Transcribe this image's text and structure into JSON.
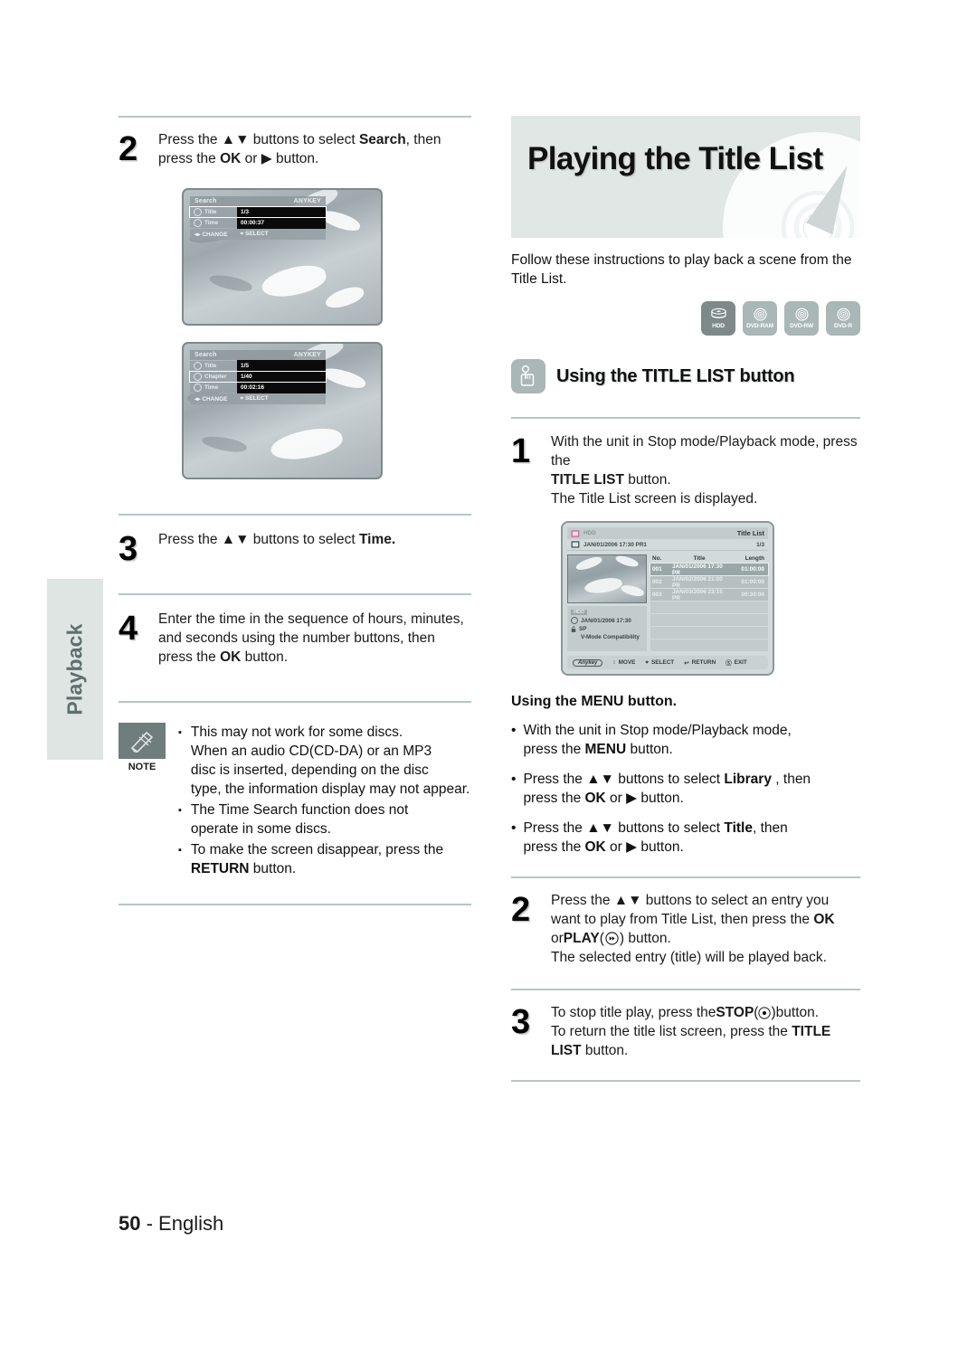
{
  "page": {
    "number": "50",
    "language": "English",
    "side_tab": "Playback"
  },
  "left_column": {
    "step2": {
      "num": "2",
      "line1_pre": "Press the ",
      "line1_arrows": "▲▼",
      "line1_mid": " buttons to select ",
      "line1_bold": "Search",
      "line1_post": ", then",
      "line2_pre": "press the ",
      "line2_bold": "OK",
      "line2_mid": " or ",
      "line2_arrow": "▶",
      "line2_post": " button."
    },
    "screen_a": {
      "title": "Search",
      "anykey": "ANYKEY",
      "rows": [
        {
          "icon": "title-icon",
          "label": "Title",
          "value": "1/3",
          "selected": true
        },
        {
          "icon": "clock-icon",
          "label": "Time",
          "value": "00:00:37",
          "selected": false
        }
      ],
      "foot_change": "CHANGE",
      "foot_select": "SELECT"
    },
    "screen_b": {
      "title": "Search",
      "anykey": "ANYKEY",
      "rows": [
        {
          "icon": "title-icon",
          "label": "Title",
          "value": "1/5",
          "selected": false
        },
        {
          "icon": "chapter-icon",
          "label": "Chapter",
          "value": "1/40",
          "selected": true
        },
        {
          "icon": "clock-icon",
          "label": "Time",
          "value": "00:02:16",
          "selected": false
        }
      ],
      "foot_change": "CHANGE",
      "foot_select": "SELECT"
    },
    "step3": {
      "num": "3",
      "pre": "Press the ",
      "arrows": "▲▼",
      "mid": " buttons to select ",
      "bold": "Time.",
      "post": ""
    },
    "step4": {
      "num": "4",
      "line1": "Enter the time in the sequence of hours, minutes,",
      "line2": "and seconds using the number buttons, then",
      "line3_pre": "press the ",
      "line3_bold": "OK",
      "line3_post": " button."
    },
    "note": {
      "icon": "pencil-note-icon",
      "caption": "NOTE",
      "items": [
        {
          "bullet": "▪",
          "lines": [
            "This may not work for some discs.",
            "When an audio CD(CD-DA) or an MP3",
            "disc is inserted, depending on the disc",
            "type, the information display may not appear."
          ]
        },
        {
          "bullet": "▪",
          "lines": [
            "The Time Search function does not",
            "operate in some discs."
          ]
        },
        {
          "bullet": "▪",
          "lines": [
            "To make the screen disappear, press the"
          ],
          "last_bold": "RETURN",
          "last_post": " button."
        }
      ]
    }
  },
  "right_column": {
    "header_title": "Playing the Title List",
    "intro_line1": "Follow these instructions to play back a scene from the",
    "intro_line2": "Title List.",
    "badges": [
      {
        "name": "hdd-badge",
        "label": "HDD",
        "glyph": "hdd-stack-icon",
        "active": true
      },
      {
        "name": "dvd-ram-badge",
        "label": "DVD-RAM",
        "glyph": "disc-icon",
        "active": false
      },
      {
        "name": "dvd-rw-badge",
        "label": "DVD-RW",
        "glyph": "disc-icon",
        "active": false
      },
      {
        "name": "dvd-r-badge",
        "label": "DVD-R",
        "glyph": "disc-icon",
        "active": false
      }
    ],
    "section_title": "Using the TITLE LIST button",
    "section_icon": "hand-press-icon",
    "step1": {
      "num": "1",
      "line1": "With the unit in Stop mode/Playback mode, press the",
      "line2_bold": "TITLE LIST",
      "line2_post": " button.",
      "line3": "The Title List screen is displayed."
    },
    "title_list_screen": {
      "source_label": "HDD",
      "source_icon": "hdd-small-icon",
      "screen_name": "Title List",
      "sub_icon": "film-icon",
      "sub_label": "JAN/01/2006 17:30 PR1",
      "page_indicator": "1/3",
      "columns": {
        "no": "No.",
        "title": "Title",
        "length": "Length"
      },
      "rows": [
        {
          "no": "001",
          "title": "JAN/01/2006 17:30 PR",
          "length": "01:00:00",
          "selected": true
        },
        {
          "no": "002",
          "title": "JAN/02/2006 21:00 PR",
          "length": "01:00:00",
          "selected": false
        },
        {
          "no": "003",
          "title": "JAN/03/2006 23:15 PR",
          "length": "00:30:00",
          "selected": false
        }
      ],
      "empty_rows": 4,
      "info": {
        "tag": "HDD",
        "date": "JAN/01/2006 17:30",
        "mode": "SP",
        "compat": "V-Mode Compatibility",
        "clock_icon": "clock-icon",
        "lock_icon": "unlock-icon"
      },
      "footer": {
        "anykey": "Anykey",
        "move": "MOVE",
        "select": "SELECT",
        "return": "RETURN",
        "exit": "EXIT"
      }
    },
    "menu_section": {
      "heading": "Using the MENU button.",
      "bullets": [
        {
          "bullet": "•",
          "line1": "With the unit in Stop mode/Playback mode,",
          "line2_pre": "press the ",
          "line2_bold": "MENU",
          "line2_post": " button."
        },
        {
          "bullet": "•",
          "line1_pre": "Press the ",
          "line1_arrows": "▲▼",
          "line1_mid": " buttons to select ",
          "line1_bold": "Library",
          "line1_post": " , then",
          "line2_pre": "press the ",
          "line2_bold": "OK",
          "line2_mid": " or ",
          "line2_arrow": "▶",
          "line2_post": " button."
        },
        {
          "bullet": "•",
          "line1_pre": "Press the ",
          "line1_arrows": "▲▼",
          "line1_mid": " buttons to select ",
          "line1_bold": "Title",
          "line1_post": ", then",
          "line2_pre": "press the ",
          "line2_bold": "OK",
          "line2_mid": " or ",
          "line2_arrow": "▶",
          "line2_post": " button."
        }
      ]
    },
    "step2": {
      "num": "2",
      "line1": "Press the ▲▼ buttons to select an entry you",
      "line2_pre": "want to play from Title List, then press the ",
      "line2_bold": "OK",
      "line3_pre": "or ",
      "line3_bold": "PLAY",
      "line3_mid": " (",
      "line3_icon": "play-icon",
      "line3_post": ") button.",
      "line4": "The selected entry (title) will be played back."
    },
    "step3": {
      "num": "3",
      "line1_pre": "To stop title play, press the ",
      "line1_bold": "STOP",
      "line1_icon": "stop-icon",
      "line1_post": " button.",
      "line2_pre": "To return the title list screen, press the ",
      "line2_bold": "TITLE",
      "line3_bold": "LIST",
      "line3_post": " button."
    }
  }
}
